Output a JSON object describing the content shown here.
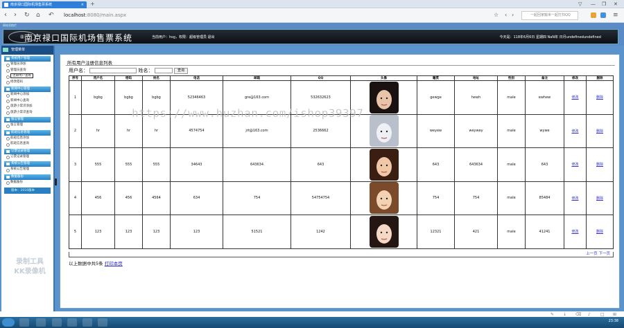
{
  "browser": {
    "tab_title": "南京禄口国际机场售票系统",
    "url_host": "localhost",
    "url_path": ":8080/main.aspx",
    "search_placeholder": "一起回家搬米一起打扫QQ"
  },
  "header": {
    "top_label": "网站导航栏",
    "title": "南京禄口国际机场售票系统",
    "user_info": "当前用户：hsg，权限：超级管理员 退出",
    "date_info": "今天是：118年6月6日 星期四 NaN年 日月undefinedundefined"
  },
  "sidebar": {
    "top_label": "管理菜单",
    "sections": [
      {
        "title": "系统用户管理",
        "items": [
          "管理员添加",
          "管理员查询",
          "注册用户查看",
          "修改密码"
        ]
      },
      {
        "title": "新闻中心管理",
        "items": [
          "新闻中心添加",
          "新闻中心查询",
          "旅游小常识添加",
          "旅游小常识查询"
        ]
      },
      {
        "title": "留言管理",
        "items": [
          "留言管理"
        ]
      },
      {
        "title": "航班信息管理",
        "items": [
          "航班信息添加",
          "航班信息查询"
        ]
      },
      {
        "title": "订票记录管理",
        "items": [
          "订票记录管理"
        ]
      },
      {
        "title": "系统公告管理",
        "items": [
          "系统公告管理"
        ]
      },
      {
        "title": "数据备份",
        "items": [
          "数据备份"
        ]
      }
    ],
    "footer": "版本：2016版本"
  },
  "watermark": {
    "line1": "录制工具",
    "line2": "KK录像机"
  },
  "stamp_text": "https://www.huzhan.com/ishop39397",
  "main": {
    "title": "所有用户注册信息列表",
    "search_username_label": "用户名：",
    "search_name_label": "姓名：",
    "search_button": "查询",
    "columns": [
      "序号",
      "用户名",
      "密码",
      "姓名",
      "电话",
      "邮箱",
      "QQ",
      "头像",
      "籍贯",
      "地址",
      "性别",
      "备注",
      "修改",
      "删除"
    ],
    "rows": [
      [
        "1",
        "bgbg",
        "bgbg",
        "bgbg",
        "52346463",
        "gre@163.com",
        "532632623",
        "",
        "gewge",
        "hewh",
        "male",
        "ewhew",
        "修改",
        "删除"
      ],
      [
        "2",
        "hr",
        "hr",
        "hr",
        "4574754",
        "jrt@163.com",
        "2536662",
        "",
        "weyew",
        "weywey",
        "male",
        "wywe",
        "修改",
        "删除"
      ],
      [
        "3",
        "555",
        "555",
        "555",
        "34643",
        "643634",
        "643",
        "",
        "643",
        "643634",
        "male",
        "643",
        "修改",
        "删除"
      ],
      [
        "4",
        "456",
        "456",
        "4564",
        "634",
        "754",
        "54754754",
        "",
        "754",
        "754",
        "male",
        "85484",
        "修改",
        "删除"
      ],
      [
        "5",
        "123",
        "123",
        "123",
        "123",
        "51521",
        "1242",
        "",
        "12321",
        "421",
        "male",
        "41241",
        "修改",
        "删除"
      ]
    ],
    "pager_prev": "上一页",
    "pager_next": "下一页",
    "total_text": "以上数据中共5条",
    "print_link": "打印本页"
  },
  "taskbar": {
    "clock": "23:38"
  },
  "colors": {
    "accent": "#5b94cc",
    "header_bar": "#0b0f14",
    "section": "#2a7fc2"
  }
}
